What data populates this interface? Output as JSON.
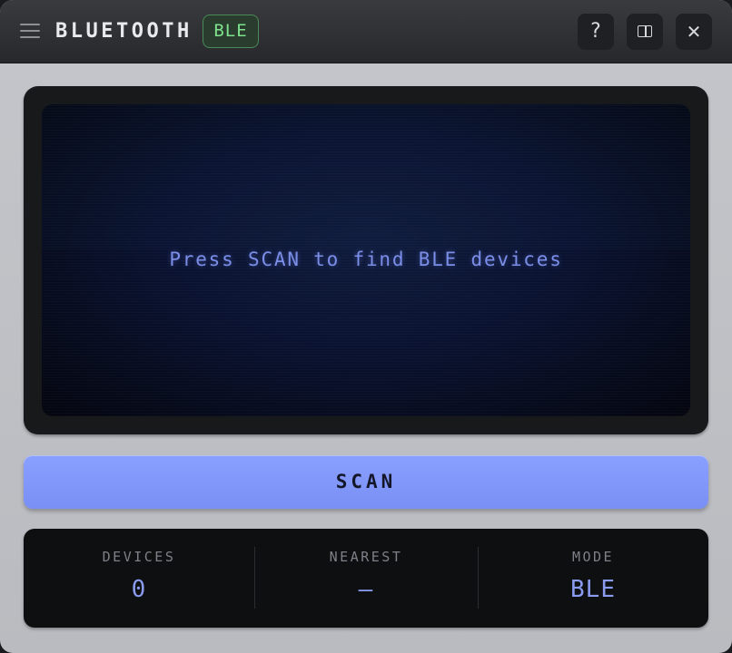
{
  "header": {
    "title": "BLUETOOTH",
    "badge": "BLE",
    "help_glyph": "?",
    "close_glyph": "✕",
    "menu_icon": "hamburger-menu-icon",
    "panel_icon": "split-panel-icon"
  },
  "display": {
    "message": "Press SCAN to find BLE devices"
  },
  "scan_button": {
    "label": "SCAN"
  },
  "stats": [
    {
      "label": "DEVICES",
      "value": "0"
    },
    {
      "label": "NEAREST",
      "value": "—"
    },
    {
      "label": "MODE",
      "value": "BLE"
    }
  ],
  "colors": {
    "accent": "#7a8ff4",
    "badge_text": "#7ee38c",
    "screen_text": "#7b8ee8",
    "stat_value": "#8b9bf0"
  }
}
